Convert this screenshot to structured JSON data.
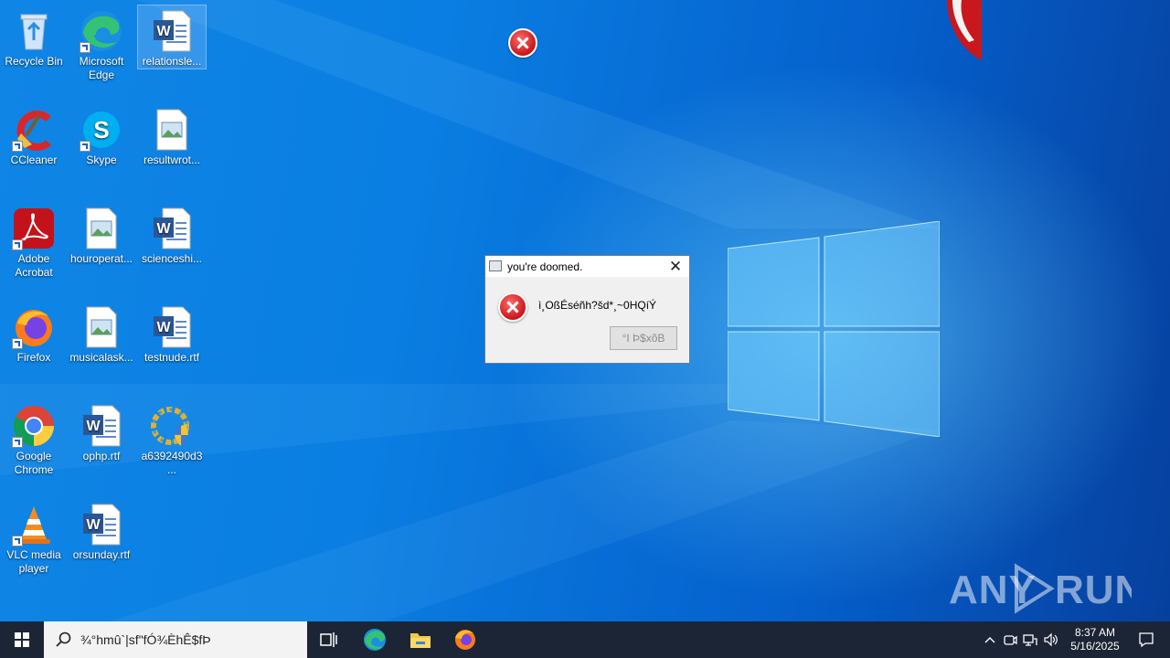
{
  "desktop_icons": [
    {
      "id": "recycle-bin",
      "label": "Recycle Bin",
      "icon": "recycle-bin-icon"
    },
    {
      "id": "edge",
      "label": "Microsoft Edge",
      "icon": "edge-icon"
    },
    {
      "id": "relationsle",
      "label": "relationsle...",
      "icon": "word-doc-icon"
    },
    {
      "id": "ccleaner",
      "label": "CCleaner",
      "icon": "ccleaner-icon"
    },
    {
      "id": "skype",
      "label": "Skype",
      "icon": "skype-icon"
    },
    {
      "id": "resultwrot",
      "label": "resultwrot...",
      "icon": "image-file-icon"
    },
    {
      "id": "acrobat",
      "label": "Adobe Acrobat",
      "icon": "acrobat-icon"
    },
    {
      "id": "houroperat",
      "label": "houroperat...",
      "icon": "image-file-icon"
    },
    {
      "id": "scienceshi",
      "label": "scienceshi...",
      "icon": "word-doc-icon"
    },
    {
      "id": "firefox",
      "label": "Firefox",
      "icon": "firefox-icon"
    },
    {
      "id": "musicalask",
      "label": "musicalask...",
      "icon": "image-file-icon"
    },
    {
      "id": "testnude",
      "label": "testnude.rtf",
      "icon": "word-doc-icon"
    },
    {
      "id": "chrome",
      "label": "Google Chrome",
      "icon": "chrome-icon"
    },
    {
      "id": "ophp",
      "label": "ophp.rtf",
      "icon": "word-doc-icon"
    },
    {
      "id": "a6392490d3",
      "label": "a6392490d3...",
      "icon": "installer-shield-icon"
    },
    {
      "id": "vlc",
      "label": "VLC media player",
      "icon": "vlc-icon"
    },
    {
      "id": "orsunday",
      "label": "orsunday.rtf",
      "icon": "word-doc-icon"
    }
  ],
  "dialog": {
    "title": "you're doomed.",
    "message": "ì¸OßÉséñh?šd*¸~0HQíÝ",
    "button_label": "°I Þ$xõB"
  },
  "watermark": "ANY RUN",
  "taskbar": {
    "search_text": "¾°hmû`|sf\"fÓ¾ÈhÊ$fÞ",
    "time": "8:37 AM",
    "date": "5/16/2025"
  },
  "colors": {
    "accent": "#0a63c9",
    "taskbar": "#1c2535",
    "error": "#c8161b"
  }
}
